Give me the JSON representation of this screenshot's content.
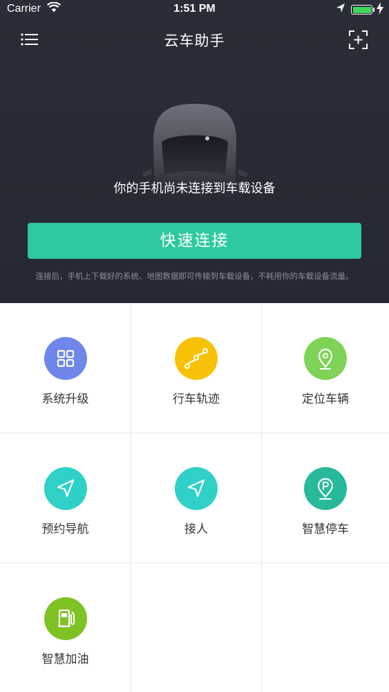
{
  "status_bar": {
    "carrier": "Carrier",
    "time": "1:51 PM"
  },
  "header": {
    "title": "云车助手"
  },
  "connection": {
    "message": "你的手机尚未连接到车载设备",
    "button_label": "快速连接",
    "description": "连接后，手机上下载好的系统、地图数据即可传输到车载设备，不耗用你的车载设备流量。"
  },
  "features": [
    {
      "label": "系统升级",
      "icon": "grid-icon",
      "color": "#6f86ea"
    },
    {
      "label": "行车轨迹",
      "icon": "route-icon",
      "color": "#f7c206"
    },
    {
      "label": "定位车辆",
      "icon": "location-pin-icon",
      "color": "#7fd357"
    },
    {
      "label": "预约导航",
      "icon": "navigation-arrow-icon",
      "color": "#2fd0c7"
    },
    {
      "label": "接人",
      "icon": "navigation-arrow-icon",
      "color": "#2fd0c7"
    },
    {
      "label": "智慧停车",
      "icon": "parking-pin-icon",
      "color": "#27b99a"
    },
    {
      "label": "智慧加油",
      "icon": "fuel-pump-icon",
      "color": "#7fc224"
    }
  ],
  "colors": {
    "header_bg": "#282a35",
    "accent": "#2ec8a2"
  }
}
